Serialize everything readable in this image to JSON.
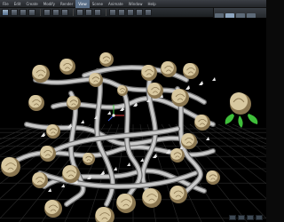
{
  "menu": {
    "items": [
      "File",
      "Edit",
      "Create",
      "Modify",
      "Render",
      "View",
      "Scene",
      "Animate",
      "Window",
      "Help"
    ],
    "active_index": 5
  },
  "toolbar": {
    "tools": [
      "select-icon",
      "move-icon",
      "rotate-icon",
      "scale-icon",
      "sep",
      "camera-icon",
      "light-icon",
      "render-icon",
      "sep",
      "snap-icon",
      "grid-icon",
      "material-icon",
      "sep",
      "undo-icon",
      "redo-icon",
      "zoom-icon",
      "pan-icon",
      "orbit-icon"
    ],
    "selected_index": 0
  },
  "right_panel": {
    "tabs": [
      "object-tab",
      "material-tab",
      "render-tab",
      "scene-tab"
    ],
    "active_index": 1
  },
  "viewport": {
    "background": "#000000",
    "grid_color": "#2c2c2c",
    "scene_colors": {
      "stem": "#c9c9c9",
      "stem_shade": "#6e6e6e",
      "rose": "#d8c8a0",
      "rose_shade": "#8a7650",
      "leaf": "#3fbf3a"
    }
  }
}
